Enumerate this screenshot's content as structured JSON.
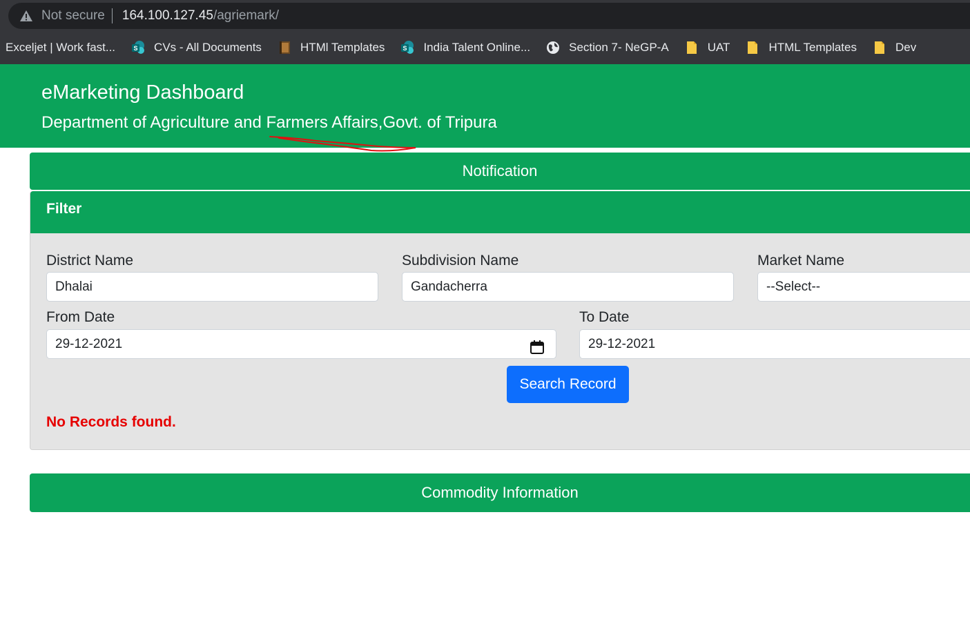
{
  "browser": {
    "security_label": "Not secure",
    "url_host": "164.100.127.45",
    "url_path": "/agriemark/"
  },
  "bookmarks": [
    {
      "label": "Exceljet | Work fast...",
      "icon": "none"
    },
    {
      "label": "CVs - All Documents",
      "icon": "sharepoint-icon"
    },
    {
      "label": "HTMl Templates",
      "icon": "book-icon"
    },
    {
      "label": "India Talent Online...",
      "icon": "sharepoint-icon"
    },
    {
      "label": "Section 7- NeGP-A",
      "icon": "globe-icon"
    },
    {
      "label": "UAT",
      "icon": "folder-icon"
    },
    {
      "label": "HTML Templates",
      "icon": "folder-icon"
    },
    {
      "label": "Dev",
      "icon": "folder-icon"
    }
  ],
  "header": {
    "title": "eMarketing Dashboard",
    "subtitle": "Department of Agriculture and Farmers Affairs,Govt. of Tripura"
  },
  "notification": {
    "label": "Notification"
  },
  "filter": {
    "title": "Filter",
    "district": {
      "label": "District Name",
      "value": "Dhalai"
    },
    "subdivision": {
      "label": "Subdivision Name",
      "value": "Gandacherra"
    },
    "market": {
      "label": "Market Name",
      "value": "--Select--"
    },
    "from_date": {
      "label": "From Date",
      "value": "29-12-2021"
    },
    "to_date": {
      "label": "To Date",
      "value": "29-12-2021"
    },
    "search_button": "Search Record",
    "message": "No Records found."
  },
  "commodity": {
    "label": "Commodity Information"
  },
  "colors": {
    "primary_green": "#0ba35a",
    "button_blue": "#0d6efd",
    "error_red": "#e60000",
    "card_bg": "#e4e4e4",
    "annotation_red": "#e01010"
  }
}
